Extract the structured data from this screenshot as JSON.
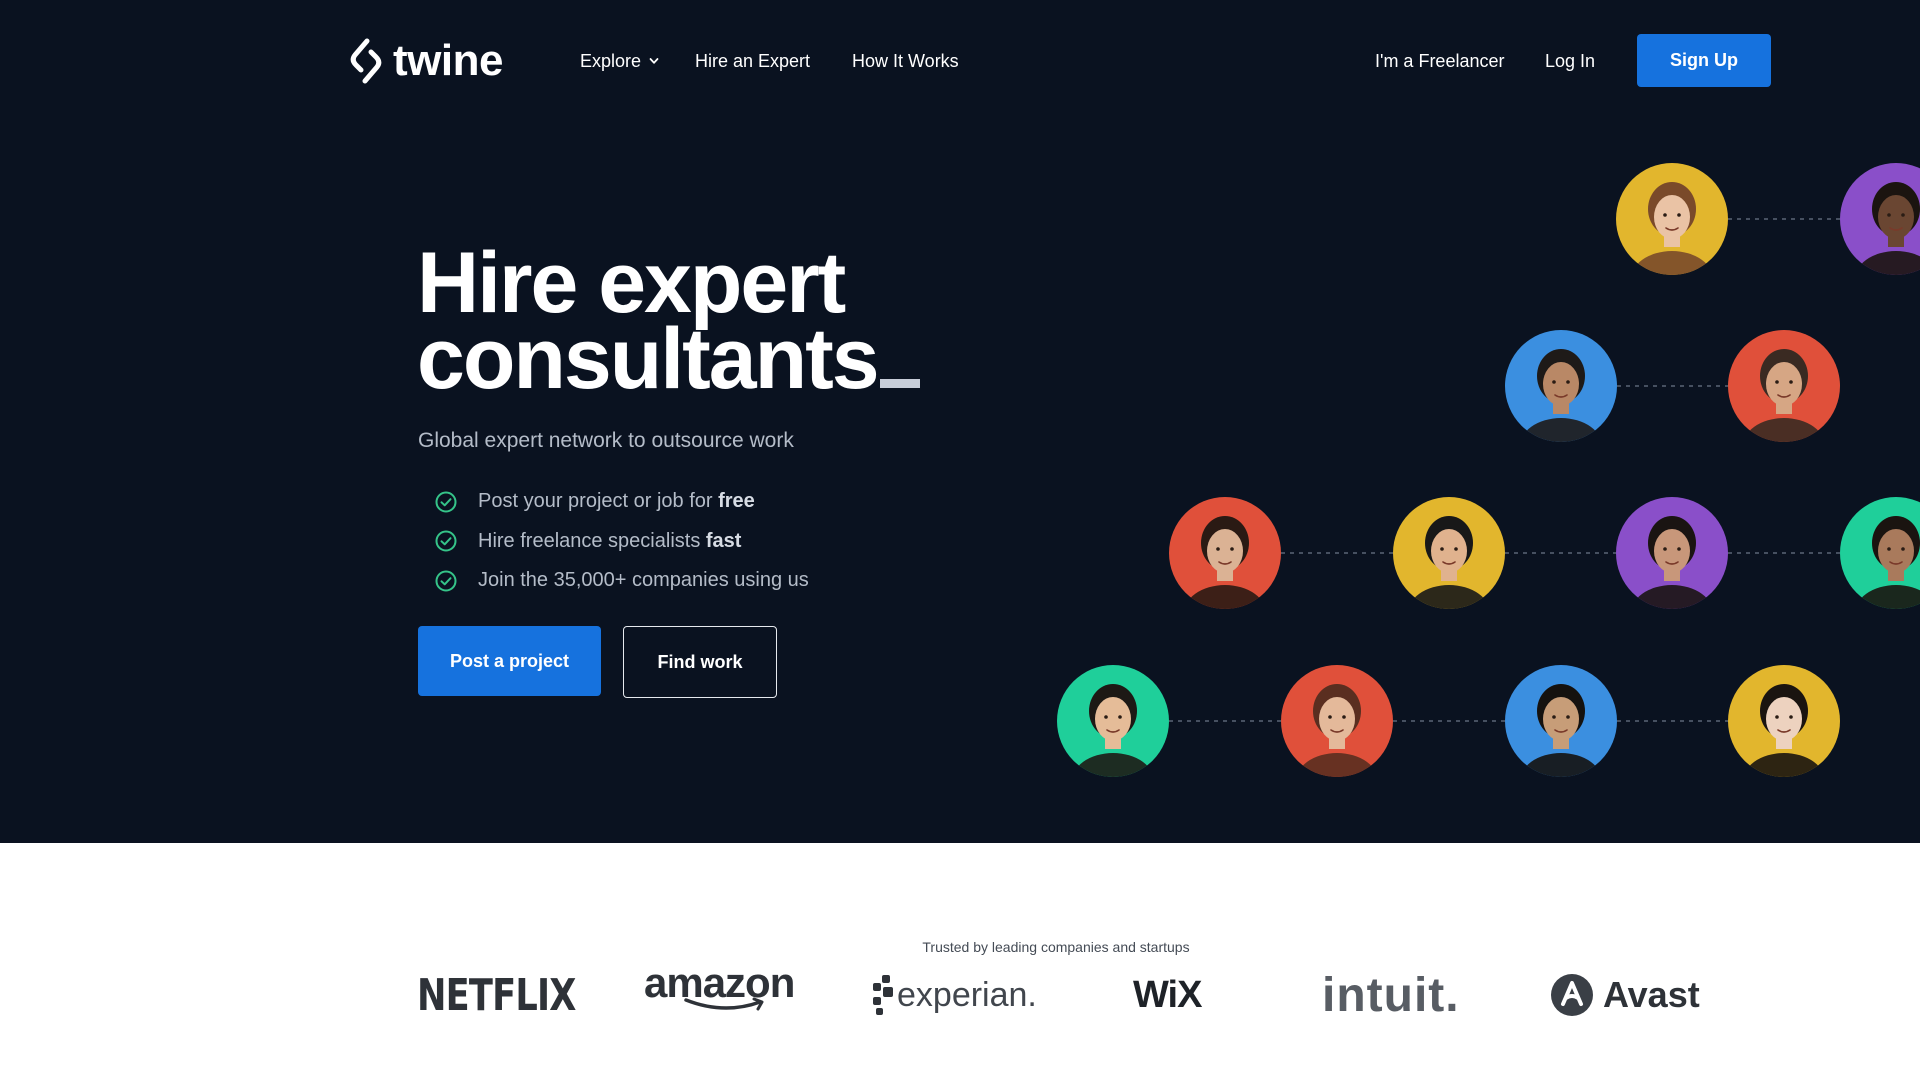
{
  "brand": {
    "name": "twine"
  },
  "nav": {
    "explore": "Explore",
    "hire_expert": "Hire an Expert",
    "how_it_works": "How It Works",
    "freelancer": "I'm a Freelancer",
    "login": "Log In",
    "signup": "Sign Up"
  },
  "hero": {
    "headline_line1": "Hire expert",
    "headline_line2": "consultants",
    "subtitle": "Global expert network to outsource work",
    "checks": [
      {
        "text": "Post your project or job for ",
        "bold": "free"
      },
      {
        "text": "Hire freelance  specialists ",
        "bold": "fast"
      },
      {
        "text": "Join the 35,000+ companies using us",
        "bold": ""
      }
    ],
    "post_project": "Post a project",
    "find_work": "Find work"
  },
  "colors": {
    "hero_bg": "#0a1220",
    "accent": "#1672de",
    "check": "#35c489"
  },
  "avatars": [
    {
      "bg": "#e2b62d",
      "skin": "#eac3a5",
      "hair": "#7a4a2a"
    },
    {
      "bg": "#8a4fc9",
      "skin": "#6a4632",
      "hair": "#1b1410"
    },
    {
      "bg": "#3b8fe0",
      "skin": "#b98866",
      "hair": "#1e1a18"
    },
    {
      "bg": "#e0503a",
      "skin": "#d6a684",
      "hair": "#3a2a22"
    },
    {
      "bg": "#e0503a",
      "skin": "#dbb294",
      "hair": "#2a1a14"
    },
    {
      "bg": "#e2b62d",
      "skin": "#e0b28e",
      "hair": "#181818"
    },
    {
      "bg": "#8a4fc9",
      "skin": "#c8977a",
      "hair": "#1a1412"
    },
    {
      "bg": "#1fcf9a",
      "skin": "#a97a5c",
      "hair": "#1a1410"
    },
    {
      "bg": "#1fcf9a",
      "skin": "#e5bc98",
      "hair": "#1d1915"
    },
    {
      "bg": "#e0503a",
      "skin": "#e4b99a",
      "hair": "#5a2e20"
    },
    {
      "bg": "#3b8fe0",
      "skin": "#c79d78",
      "hair": "#15120f"
    },
    {
      "bg": "#e2b62d",
      "skin": "#edd2bf",
      "hair": "#1a1410"
    }
  ],
  "trusted_text": "Trusted by leading  companies and startups",
  "logos": {
    "netflix": "NETFLIX",
    "amazon": "amazon",
    "experian": "experian.",
    "wix": "WiX",
    "intuit": "intuit.",
    "avast": "Avast"
  }
}
